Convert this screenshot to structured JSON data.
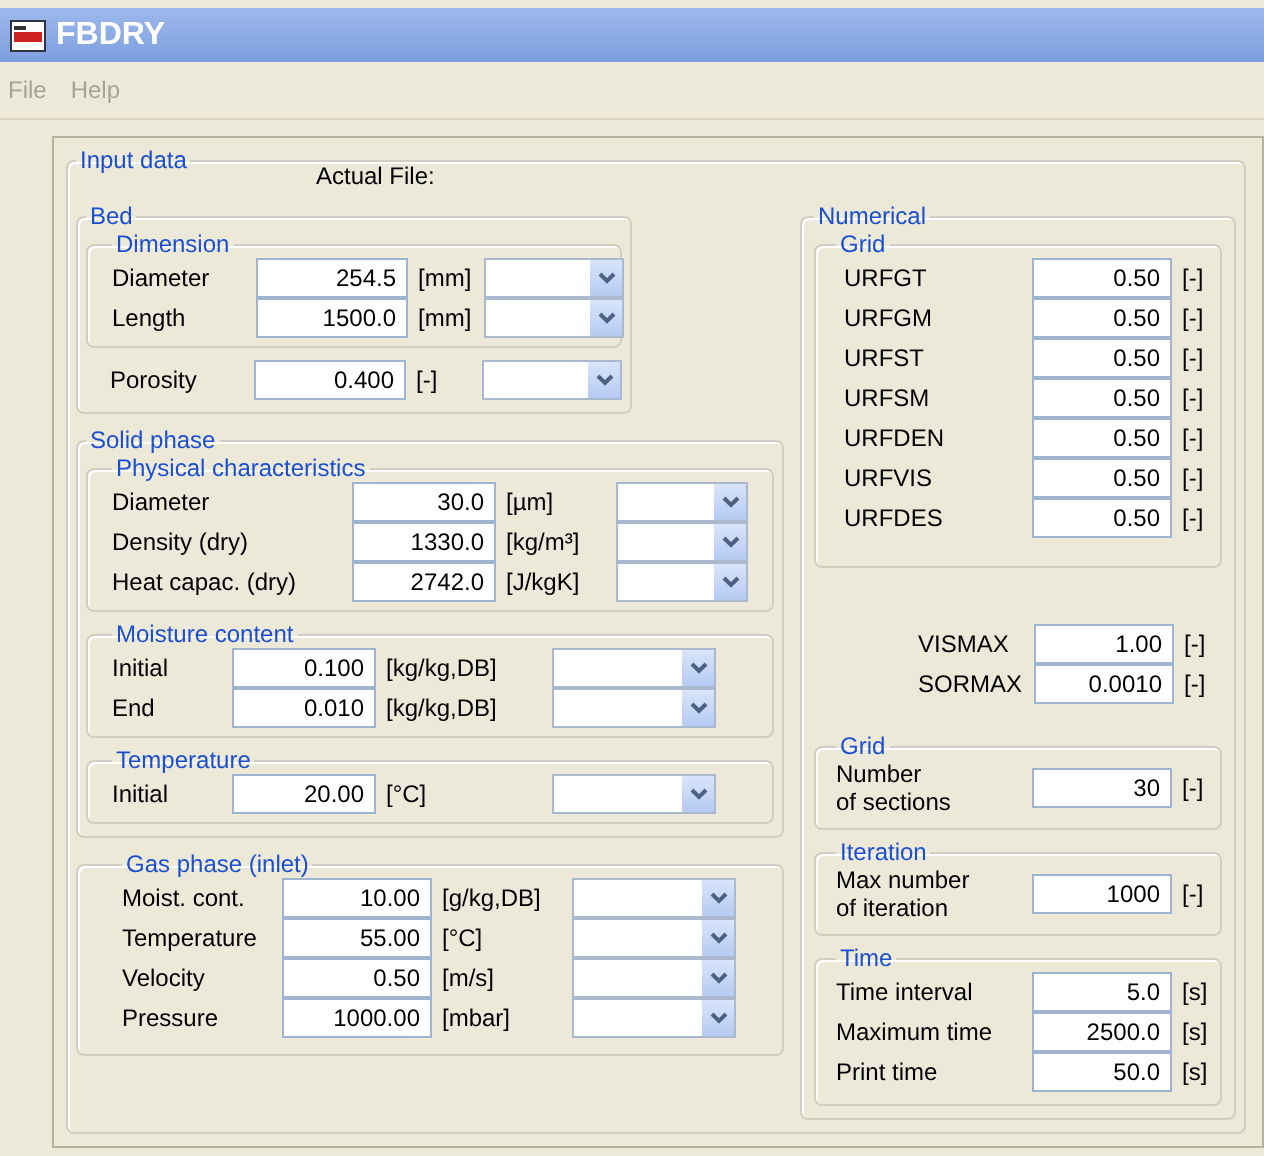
{
  "window": {
    "title": "FBDRY"
  },
  "menu": [
    {
      "label": "File",
      "disabled": true
    },
    {
      "label": "Help",
      "disabled": true
    }
  ],
  "input_data": {
    "title": "Input data",
    "actual_file_label": "Actual File:",
    "bed": {
      "title": "Bed",
      "dimension": {
        "title": "Dimension",
        "rows": [
          {
            "label": "Diameter",
            "value": "254.5",
            "unit": "[mm]"
          },
          {
            "label": "Length",
            "value": "1500.0",
            "unit": "[mm]"
          }
        ]
      },
      "rows": [
        {
          "label": "Porosity",
          "value": "0.400",
          "unit": "[-]"
        }
      ]
    },
    "solid_phase": {
      "title": "Solid phase",
      "groups": [
        {
          "title": "Physical characteristics",
          "rows": [
            {
              "label": "Diameter",
              "value": "30.0",
              "unit": "[µm]"
            },
            {
              "label": "Density (dry)",
              "value": "1330.0",
              "unit": "[kg/m³]"
            },
            {
              "label": "Heat capac. (dry)",
              "value": "2742.0",
              "unit": "[J/kgK]"
            }
          ]
        },
        {
          "title": "Moisture content",
          "rows": [
            {
              "label": "Initial",
              "value": "0.100",
              "unit": "[kg/kg,DB]"
            },
            {
              "label": "End",
              "value": "0.010",
              "unit": "[kg/kg,DB]"
            }
          ]
        },
        {
          "title": "Temperature",
          "rows": [
            {
              "label": "Initial",
              "value": "20.00",
              "unit": "[°C]"
            }
          ]
        }
      ]
    },
    "gas_phase": {
      "title": "Gas phase (inlet)",
      "rows": [
        {
          "label": "Moist. cont.",
          "value": "10.00",
          "unit": "[g/kg,DB]"
        },
        {
          "label": "Temperature",
          "value": "55.00",
          "unit": "[°C]"
        },
        {
          "label": "Velocity",
          "value": "0.50",
          "unit": "[m/s]"
        },
        {
          "label": "Pressure",
          "value": "1000.00",
          "unit": "[mbar]"
        }
      ]
    }
  },
  "numerical": {
    "title": "Numerical",
    "grid": {
      "title": "Grid",
      "rows": [
        {
          "label": "URFGT",
          "value": "0.50",
          "unit": "[-]"
        },
        {
          "label": "URFGM",
          "value": "0.50",
          "unit": "[-]"
        },
        {
          "label": "URFST",
          "value": "0.50",
          "unit": "[-]"
        },
        {
          "label": "URFSM",
          "value": "0.50",
          "unit": "[-]"
        },
        {
          "label": "URFDEN",
          "value": "0.50",
          "unit": "[-]"
        },
        {
          "label": "URFVIS",
          "value": "0.50",
          "unit": "[-]"
        },
        {
          "label": "URFDES",
          "value": "0.50",
          "unit": "[-]"
        }
      ]
    },
    "rows": [
      {
        "label": "VISMAX",
        "value": "1.00",
        "unit": "[-]"
      },
      {
        "label": "SORMAX",
        "value": "0.0010",
        "unit": "[-]"
      }
    ],
    "groups": [
      {
        "title": "Grid",
        "rows": [
          {
            "label": "Number\nof sections",
            "value": "30",
            "unit": "[-]"
          }
        ]
      },
      {
        "title": "Iteration",
        "rows": [
          {
            "label": "Max number\nof iteration",
            "value": "1000",
            "unit": "[-]"
          }
        ]
      },
      {
        "title": "Time",
        "rows": [
          {
            "label": "Time interval",
            "value": "5.0",
            "unit": "[s]"
          },
          {
            "label": "Maximum time",
            "value": "2500.0",
            "unit": "[s]"
          },
          {
            "label": "Print time",
            "value": "50.0",
            "unit": "[s]"
          }
        ]
      }
    ]
  }
}
